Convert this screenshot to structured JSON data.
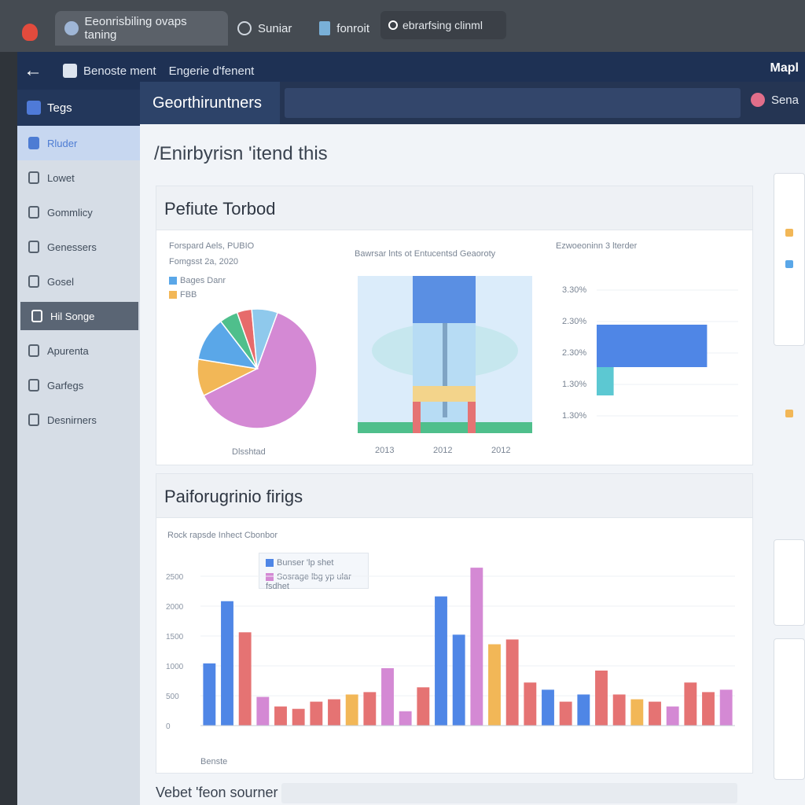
{
  "browser": {
    "tabs": [
      {
        "label": "Eeonrisbiling ovaps taning",
        "icon": "user-icon"
      },
      {
        "label": "Suniar",
        "icon": "globe-icon"
      },
      {
        "label": "fonroit",
        "icon": "chart-icon"
      }
    ],
    "search_value": "ebrarfsing clinml"
  },
  "navbar": {
    "items": [
      "Benoste ment",
      "Engerie d'fenent"
    ],
    "user": "Mapl"
  },
  "sidebar": {
    "header": "Tegs",
    "items": [
      {
        "label": "Rluder",
        "icon": "folder-icon"
      },
      {
        "label": "Lowet",
        "icon": "file-icon"
      },
      {
        "label": "Gommlicy",
        "icon": "list-icon"
      },
      {
        "label": "Genessers",
        "icon": "doc-icon"
      },
      {
        "label": "Gosel",
        "icon": "chat-icon"
      },
      {
        "label": "Hil Songe",
        "icon": "layers-icon",
        "selected": true
      },
      {
        "label": "Apurenta",
        "icon": "clipboard-icon"
      },
      {
        "label": "Garfegs",
        "icon": "grid-icon"
      },
      {
        "label": "Desnirners",
        "icon": "page-icon"
      }
    ]
  },
  "main": {
    "tab_label": "Georthiruntners",
    "right_label": "Sena",
    "page_title": "/Enirbyrisn 'itend this",
    "panel1_title": "Pefiute Torbod",
    "panel2_title": "Paiforugrinio firigs",
    "footer_label": "Vebet 'feon sourner"
  },
  "chart_data": [
    {
      "type": "pie",
      "title": "Forspard Aels, PUBIO",
      "subtitle": "Fomgsst 2a, 2020",
      "legend": [
        "Bages Danr",
        "FBB"
      ],
      "xlabel": "Dlsshtad",
      "slices": [
        {
          "value": 62,
          "color": "#d489d4"
        },
        {
          "value": 10,
          "color": "#f2b757"
        },
        {
          "value": 12,
          "color": "#5aa7e8"
        },
        {
          "value": 5,
          "color": "#4fbf8c"
        },
        {
          "value": 4,
          "color": "#e66b6b"
        },
        {
          "value": 7,
          "color": "#8fc9ec"
        }
      ]
    },
    {
      "type": "bar",
      "title": "Bawrsar lnts ot Entucentsd Geaoroty",
      "categories": [
        "2013",
        "2012",
        "2012"
      ]
    },
    {
      "type": "bar",
      "title": "Ezwoeoninn 3 lterder",
      "ticks": [
        "3.30%",
        "2.30%",
        "2.30%",
        "1.30%",
        "1.30%"
      ],
      "bars": [
        {
          "value": 0.78,
          "color": "#4f86e6"
        },
        {
          "value": 0.12,
          "color": "#5cc8d2"
        }
      ]
    },
    {
      "type": "bar",
      "title": "Rock rapsde Inhect Cbonbor",
      "legend": [
        "Bunser 'lp shet",
        "Sosrage lbg yp ular fsdhet"
      ],
      "ylabel": "Benste",
      "yticks": [
        "2500",
        "2000",
        "1500",
        "1000",
        "500",
        "0"
      ],
      "ylim": [
        0,
        3000
      ],
      "series_colors": [
        "#4f86e6",
        "#e57373",
        "#d489d4",
        "#f2b757",
        "#a9d3f5"
      ],
      "values": [
        {
          "v": 1300,
          "c": 0
        },
        {
          "v": 2600,
          "c": 0
        },
        {
          "v": 1950,
          "c": 1
        },
        {
          "v": 600,
          "c": 2
        },
        {
          "v": 400,
          "c": 1
        },
        {
          "v": 350,
          "c": 1
        },
        {
          "v": 500,
          "c": 1
        },
        {
          "v": 550,
          "c": 1
        },
        {
          "v": 650,
          "c": 3
        },
        {
          "v": 700,
          "c": 1
        },
        {
          "v": 1200,
          "c": 2
        },
        {
          "v": 300,
          "c": 2
        },
        {
          "v": 800,
          "c": 1
        },
        {
          "v": 2700,
          "c": 0
        },
        {
          "v": 1900,
          "c": 0
        },
        {
          "v": 3300,
          "c": 2
        },
        {
          "v": 1700,
          "c": 3
        },
        {
          "v": 1800,
          "c": 1
        },
        {
          "v": 900,
          "c": 1
        },
        {
          "v": 750,
          "c": 0
        },
        {
          "v": 500,
          "c": 1
        },
        {
          "v": 650,
          "c": 0
        },
        {
          "v": 1150,
          "c": 1
        },
        {
          "v": 650,
          "c": 1
        },
        {
          "v": 550,
          "c": 3
        },
        {
          "v": 500,
          "c": 1
        },
        {
          "v": 400,
          "c": 2
        },
        {
          "v": 900,
          "c": 1
        },
        {
          "v": 700,
          "c": 1
        },
        {
          "v": 750,
          "c": 2
        }
      ]
    }
  ]
}
